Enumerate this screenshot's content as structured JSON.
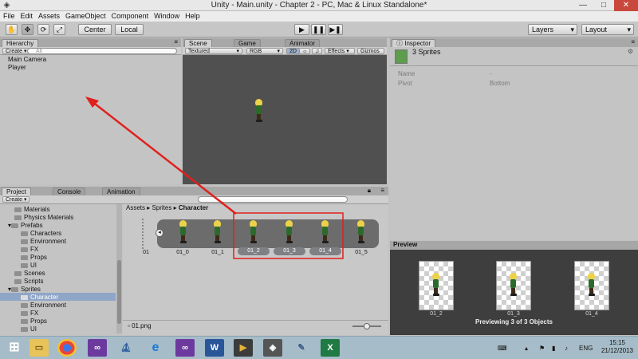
{
  "window": {
    "title": "Unity - Main.unity - Chapter 2 - PC, Mac & Linux Standalone*",
    "minimize": "—",
    "maximize": "□",
    "close": "✕"
  },
  "menu": [
    "File",
    "Edit",
    "Assets",
    "GameObject",
    "Component",
    "Window",
    "Help"
  ],
  "toolbar": {
    "center": "Center",
    "local": "Local",
    "layers": "Layers",
    "layout": "Layout"
  },
  "hierarchy": {
    "tab": "Hierarchy",
    "create": "Create",
    "search_placeholder": "All",
    "items": [
      "Main Camera",
      "Player"
    ]
  },
  "scene": {
    "tab_scene": "Scene",
    "tab_game": "Game",
    "tab_animator": "Animator",
    "shading": "Textured",
    "rgb": "RGB",
    "mode_2d": "2D",
    "effects": "Effects",
    "gizmos": "Gizmos"
  },
  "inspector": {
    "tab": "Inspector",
    "header": "3 Sprites",
    "name_label": "Name",
    "name_value": "-",
    "pivot_label": "Pivot",
    "pivot_value": "Bottom"
  },
  "project": {
    "tab_project": "Project",
    "tab_console": "Console",
    "tab_animation": "Animation",
    "create": "Create",
    "tree": [
      "Materials",
      "Physics Materials",
      "Prefabs",
      "Characters",
      "Environment",
      "FX",
      "Props",
      "UI",
      "Scenes",
      "Scripts",
      "Sprites",
      "Character",
      "Environment",
      "FX",
      "Props",
      "UI"
    ],
    "breadcrumb": [
      "Assets",
      "Sprites",
      "Character"
    ],
    "parent_file": "01",
    "frames": [
      "01_0",
      "01_1",
      "01_2",
      "01_3",
      "01_4",
      "01_5"
    ],
    "selected_file": "01.png"
  },
  "preview": {
    "title": "Preview",
    "labels": [
      "01_2",
      "01_3",
      "01_4"
    ],
    "caption": "Previewing 3 of 3 Objects"
  },
  "taskbar": {
    "lang": "ENG",
    "time": "15:15",
    "date": "21/12/2013"
  },
  "colors": {
    "annotation": "#e0201c",
    "selection": "#8fa6c8"
  }
}
